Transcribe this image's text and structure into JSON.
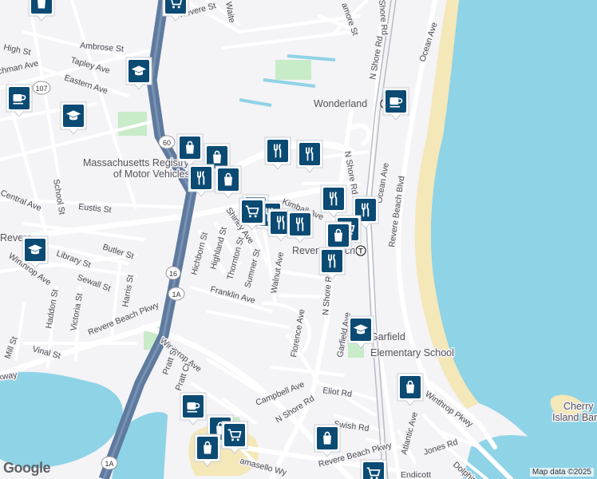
{
  "map": {
    "attribution": "Map data ©2025",
    "logo": "Google",
    "labels": {
      "revere_st_top": "Revere St",
      "waite": "Waite",
      "shore_rd_top": "Shore Rd",
      "mamore": "amore St",
      "ocean_ave_top": "Ocean Ave",
      "ambrose": "Ambrose St",
      "high_st": "High St",
      "tapley": "Tapley Ave",
      "eastern": "Eastern Ave",
      "chman": "chman Ave",
      "n_shore_rd_upper": "N Shore Rd",
      "wonderland": "Wonderland",
      "mass_rmv_1": "Massachusetts Registry",
      "mass_rmv_2": "of Motor Vehicles",
      "school_st": "School St",
      "central": "Central Ave",
      "eustis": "Eustis St",
      "butler": "Butler St",
      "library": "Library St",
      "sewall": "Sewall St",
      "revere_city": "Revere",
      "winthrop_ave_left": "Winthrop Ave",
      "kimball": "Kimball Ave",
      "shirley": "Shirley Ave",
      "hichborn": "Hichborn St",
      "highland": "Highland St",
      "thornton": "Thornton St",
      "sumner": "Sumner St",
      "walnut": "Walnut Ave",
      "revere_station": "Revere Beach",
      "n_shore_rd_mid": "N Shore Rd",
      "n_shore_rd_upper2": "N Shore Rd",
      "ocean_ave_mid": "Ocean Ave",
      "revere_beach_blvd": "Revere Beach Blvd",
      "franklin": "Franklin Ave",
      "harris": "Harris St",
      "haddon": "Haddon St",
      "victoria": "Victoria St",
      "revere_beach_pkwy": "Revere Beach Pkwy",
      "mill": "Mill St",
      "vinal": "Vinal St",
      "winthrop_ave": "Winthrop Ave",
      "florence": "Florence Ave",
      "garfield_ave": "Garfield Ave",
      "garfield_school_1": "Garfield",
      "garfield_school_2": "Elementary School",
      "kway": "kway",
      "pratt_st": "Pratt St",
      "pratt_ct": "Pratt Ct",
      "campbell": "Campbell Ave",
      "n_shore_rd_low": "N Shore Rd",
      "eliot": "Eliot Rd",
      "swish": "Swish Rd",
      "winthrop_pkwy": "Winthrop Pkwy",
      "cherry_1": "Cherry",
      "cherry_2": "Island Bar",
      "atlantic": "Atlantic Ave",
      "jones": "Jones Rd",
      "dolphin": "Dolphin",
      "pkwy_low": "Revere Beach Pkwy",
      "amasello": "amasello Wy",
      "endicott": "Endicott",
      "route_107": "107",
      "route_60": "60",
      "route_16": "16",
      "route_1a": "1A",
      "route_1a_low": "1A"
    }
  },
  "colors": {
    "water": "#8fd3e6",
    "beach": "#f4e7b8",
    "park": "#c8ebc8",
    "highway": "#5e7a9e",
    "pin": "#0b4a73"
  },
  "pins": [
    {
      "name": "shopping-pin",
      "icon": "bag"
    },
    {
      "name": "shopping-pin",
      "icon": "cart"
    },
    {
      "name": "cafe-pin",
      "icon": "cup"
    },
    {
      "name": "school-pin",
      "icon": "cap"
    },
    {
      "name": "school-pin",
      "icon": "cap"
    },
    {
      "name": "cafe-pin",
      "icon": "cup"
    },
    {
      "name": "shopping-pin",
      "icon": "bag"
    },
    {
      "name": "shopping-pin",
      "icon": "bag"
    },
    {
      "name": "restaurant-pin",
      "icon": "fork"
    },
    {
      "name": "restaurant-pin",
      "icon": "fork"
    },
    {
      "name": "restaurant-pin",
      "icon": "fork"
    },
    {
      "name": "shopping-pin",
      "icon": "bag"
    },
    {
      "name": "restaurant-pin",
      "icon": "fork"
    },
    {
      "name": "restaurant-pin",
      "icon": "fork"
    },
    {
      "name": "restaurant-pin",
      "icon": "fork"
    },
    {
      "name": "shopping-pin",
      "icon": "cart"
    },
    {
      "name": "restaurant-pin",
      "icon": "fork"
    },
    {
      "name": "restaurant-pin",
      "icon": "fork"
    },
    {
      "name": "restaurant-pin",
      "icon": "fork"
    },
    {
      "name": "shopping-pin",
      "icon": "cart"
    },
    {
      "name": "shopping-pin",
      "icon": "bag"
    },
    {
      "name": "restaurant-pin",
      "icon": "fork"
    },
    {
      "name": "school-pin",
      "icon": "cap"
    },
    {
      "name": "school-pin",
      "icon": "cap"
    },
    {
      "name": "shopping-pin",
      "icon": "bag"
    },
    {
      "name": "cafe-pin",
      "icon": "cup"
    },
    {
      "name": "shopping-pin",
      "icon": "bag"
    },
    {
      "name": "shopping-pin",
      "icon": "cart"
    },
    {
      "name": "shopping-pin",
      "icon": "bag"
    },
    {
      "name": "shopping-pin",
      "icon": "bag"
    },
    {
      "name": "shopping-pin",
      "icon": "cart"
    }
  ]
}
